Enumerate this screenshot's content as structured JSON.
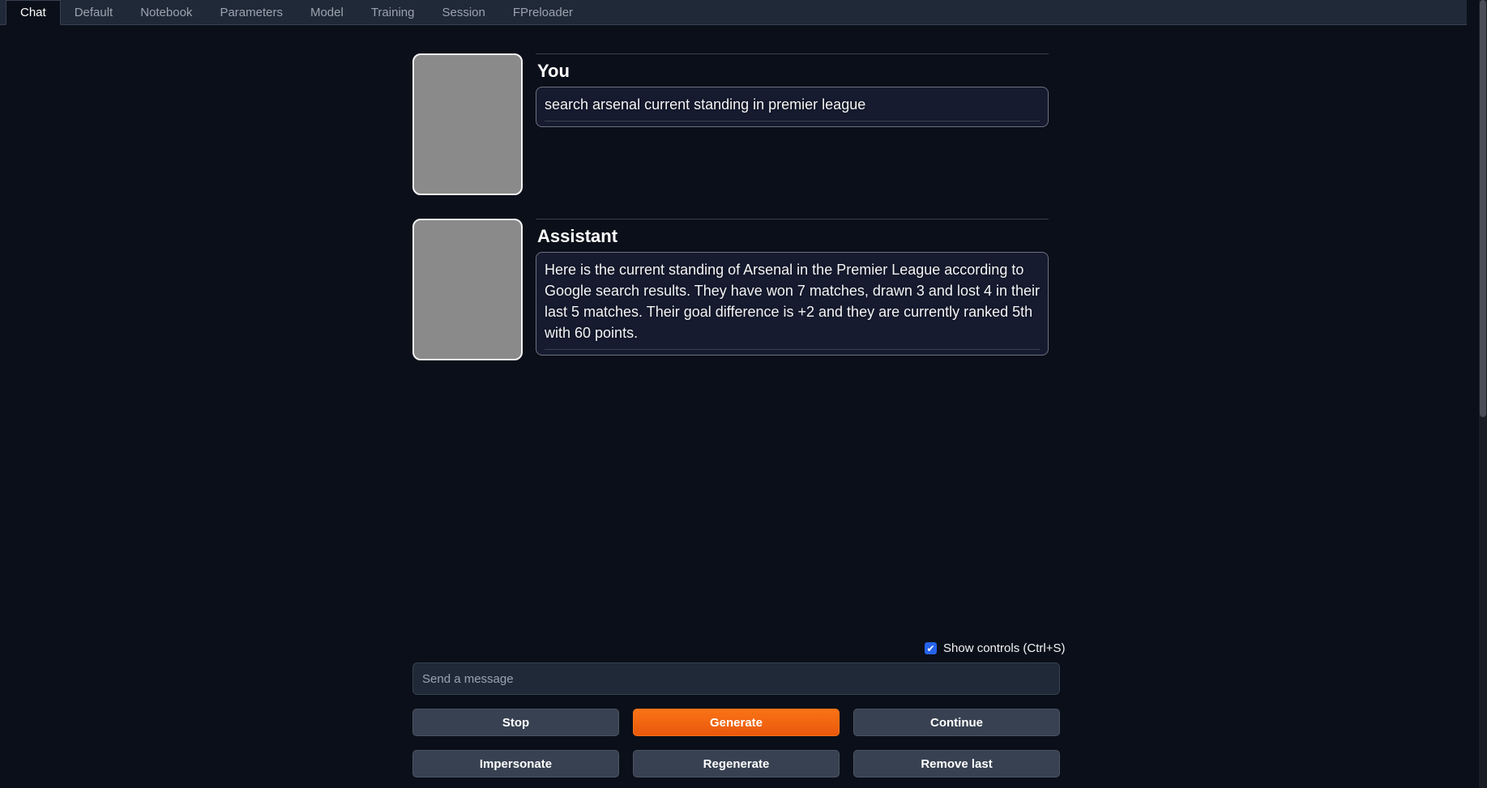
{
  "tabs": [
    {
      "label": "Chat",
      "active": true
    },
    {
      "label": "Default"
    },
    {
      "label": "Notebook"
    },
    {
      "label": "Parameters"
    },
    {
      "label": "Model"
    },
    {
      "label": "Training"
    },
    {
      "label": "Session"
    },
    {
      "label": "FPreloader"
    }
  ],
  "messages": [
    {
      "sender": "You",
      "text": "search arsenal current standing in premier league"
    },
    {
      "sender": "Assistant",
      "text": "Here is the current standing of Arsenal in the Premier League according to Google search results. They have won 7 matches, drawn 3 and lost 4 in their last 5 matches. Their goal difference is +2 and they are currently ranked 5th with 60 points."
    }
  ],
  "controls": {
    "show_controls_label": "Show controls (Ctrl+S)",
    "show_controls_checked": true
  },
  "input": {
    "placeholder": "Send a message",
    "value": ""
  },
  "buttons": {
    "stop": "Stop",
    "generate": "Generate",
    "continue": "Continue",
    "impersonate": "Impersonate",
    "regenerate": "Regenerate",
    "remove_last": "Remove last"
  },
  "colors": {
    "background": "#0b0f19",
    "accent": "#f97316",
    "checkbox": "#2563eb"
  }
}
